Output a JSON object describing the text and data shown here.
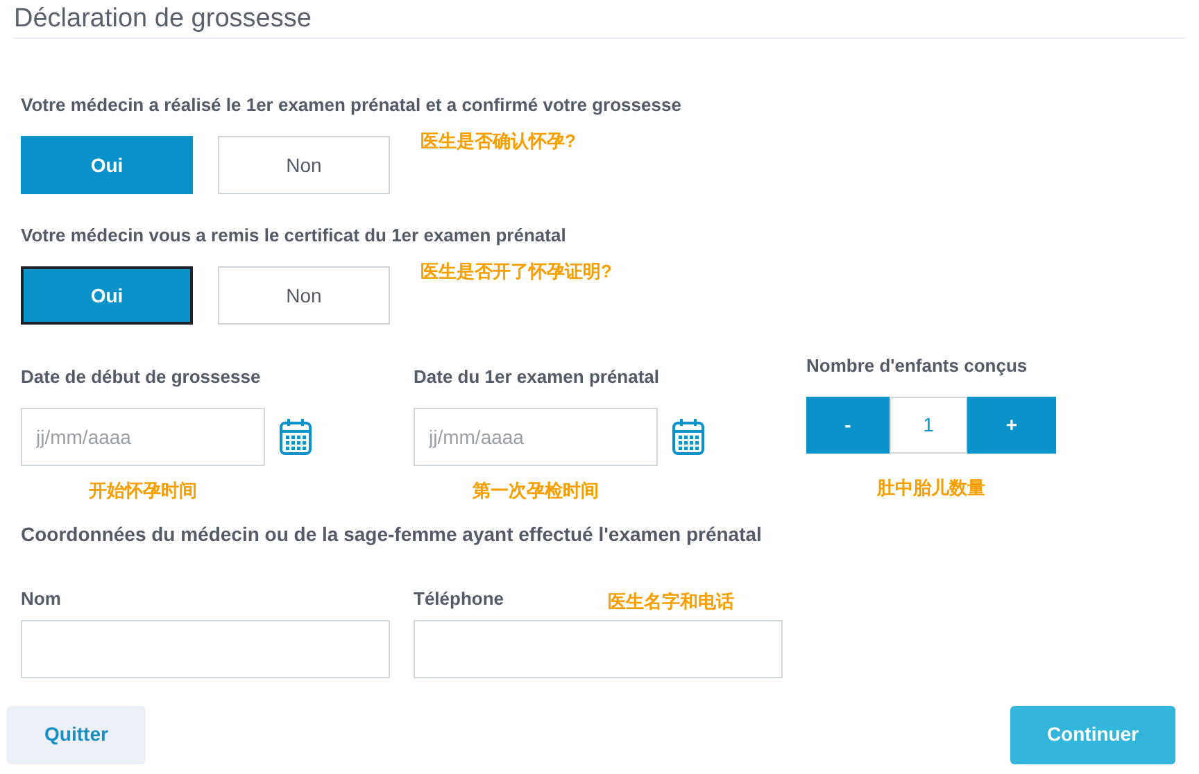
{
  "title": "Déclaration de grossesse",
  "questions": [
    {
      "label": "Votre médecin a réalisé le 1er examen prénatal et a confirmé votre grossesse",
      "note": "医生是否确认怀孕?",
      "options": [
        {
          "label": "Oui",
          "selected": true,
          "focused": false
        },
        {
          "label": "Non",
          "selected": false,
          "focused": false
        }
      ]
    },
    {
      "label": "Votre médecin vous a remis le certificat du 1er examen prénatal",
      "note": "医生是否开了怀孕证明?",
      "options": [
        {
          "label": "Oui",
          "selected": true,
          "focused": true
        },
        {
          "label": "Non",
          "selected": false,
          "focused": false
        }
      ]
    }
  ],
  "dates": [
    {
      "label": "Date de début de grossesse",
      "placeholder": "jj/mm/aaaa",
      "note": "开始怀孕时间"
    },
    {
      "label": "Date du 1er examen prénatal",
      "placeholder": "jj/mm/aaaa",
      "note": "第一次孕检时间"
    }
  ],
  "children_count": {
    "label": "Nombre d'enfants conçus",
    "minus": "-",
    "value": "1",
    "plus": "+",
    "note": "肚中胎儿数量"
  },
  "doctor": {
    "heading": "Coordonnées du médecin ou de la sage-femme ayant effectué l'examen prénatal",
    "fields": [
      {
        "label": "Nom"
      },
      {
        "label": "Téléphone"
      }
    ],
    "note": "医生名字和电话"
  },
  "buttons": {
    "quit": "Quitter",
    "continue": "Continuer"
  }
}
